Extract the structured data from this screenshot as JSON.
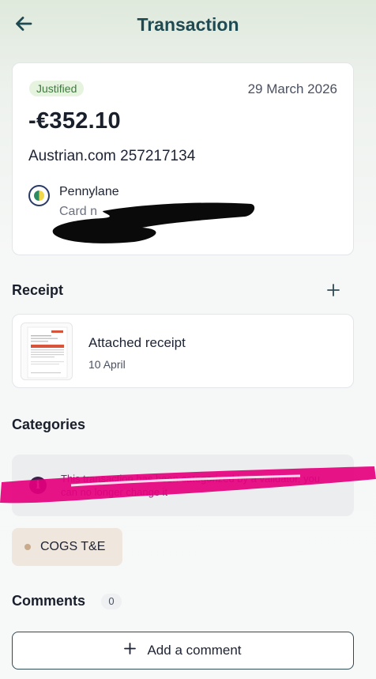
{
  "header": {
    "title": "Transaction",
    "back_icon": "arrow-left-icon"
  },
  "transaction": {
    "status": "Justified",
    "date": "29 March 2026",
    "amount": "-€352.10",
    "merchant": "Austrian.com 257217134",
    "account_name": "Pennylane",
    "account_card_label": "Card n"
  },
  "receipt": {
    "section_title": "Receipt",
    "add_icon": "plus-icon",
    "item_title": "Attached receipt",
    "item_date": "10 April"
  },
  "categories": {
    "section_title": "Categories",
    "info_icon": "info-icon",
    "info_text": "This transaction has been categorized by a validator, you can no longer change it",
    "chip_label": "COGS T&E"
  },
  "comments": {
    "section_title": "Comments",
    "count": "0",
    "add_label": "Add a comment"
  },
  "colors": {
    "accent": "#1f4a52",
    "badge_bg": "#e5f3df",
    "badge_text": "#3f7a3d",
    "chip_bg": "#efe6dd",
    "highlight": "#e5007e"
  }
}
